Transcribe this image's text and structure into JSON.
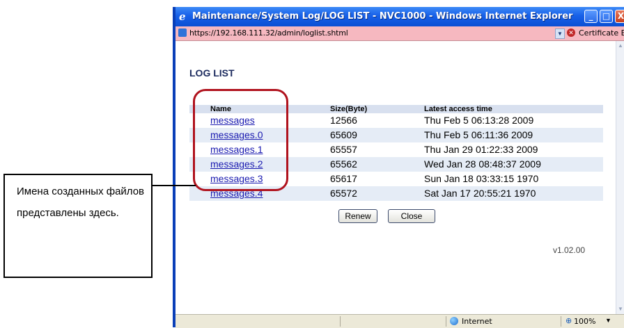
{
  "window": {
    "title": "Maintenance/System Log/LOG LIST - NVC1000 - Windows Internet Explorer",
    "minimize_glyph": "_",
    "maximize_glyph": "□",
    "close_glyph": "X"
  },
  "address_bar": {
    "url": "https://192.168.111.32/admin/loglist.shtml",
    "certificate_label": "Certificate Error"
  },
  "page": {
    "title": "LOG LIST",
    "columns": [
      "Name",
      "Size(Byte)",
      "Latest access time"
    ],
    "rows": [
      {
        "name": "messages",
        "size": "12566",
        "time": "Thu Feb 5 06:13:28 2009"
      },
      {
        "name": "messages.0",
        "size": "65609",
        "time": "Thu Feb 5 06:11:36 2009"
      },
      {
        "name": "messages.1",
        "size": "65557",
        "time": "Thu Jan 29 01:22:33 2009"
      },
      {
        "name": "messages.2",
        "size": "65562",
        "time": "Wed Jan 28 08:48:37 2009"
      },
      {
        "name": "messages.3",
        "size": "65617",
        "time": "Sun Jan 18 03:33:15 1970"
      },
      {
        "name": "messages.4",
        "size": "65572",
        "time": "Sat Jan 17 20:55:21 1970"
      }
    ],
    "renew_label": "Renew",
    "close_label": "Close",
    "version": "v1.02.00"
  },
  "status_bar": {
    "zone": "Internet",
    "zoom": "100%"
  },
  "callout": {
    "text": "Имена созданных файлов представлены здесь."
  },
  "colors": {
    "titlebar": "#1760e8",
    "address_bar_error": "#f6b8c0",
    "highlight": "#b0121d",
    "table_header": "#d8e0ef",
    "link": "#1a1ab0"
  }
}
